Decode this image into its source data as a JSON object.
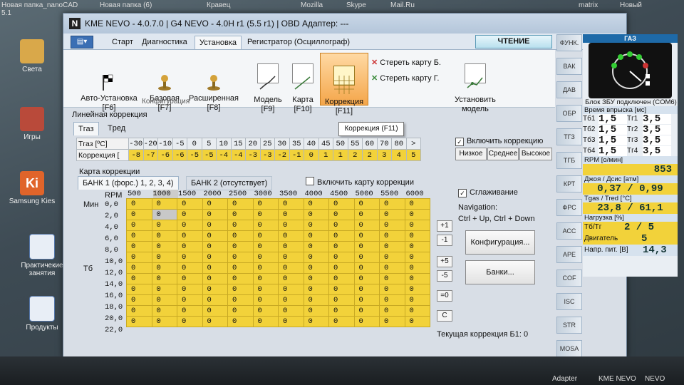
{
  "window": {
    "title": "KME NEVO - 4.0.7.0  |  G4 NEVO - 4.0H r1 (5.5 r1)  |  OBD Адаптер: ---"
  },
  "desktop": {
    "top_labels": [
      "Новая папка_nanoCAD 5.1",
      "Новая папка (6)",
      "Кравец",
      "Mozilla",
      "Skype",
      "Mail.Ru",
      "matrix",
      "Новый"
    ],
    "icons": [
      "Света",
      "Игры",
      "Samsung Kies",
      "Практичекие занятия",
      "Продукты"
    ],
    "taskbar_labels": [
      "Adapter",
      "KME NEVO",
      "NEVO"
    ]
  },
  "menu": {
    "tabs": [
      "Старт",
      "Диагностика",
      "Установка",
      "Регистратор (Осциллограф)"
    ],
    "active_tab": "Установка",
    "read_button": "ЧТЕНИЕ"
  },
  "ribbon": {
    "auto_setup": "Авто-Установка\n[F6]",
    "basic": "Базовая\n[F7]",
    "extended": "Расширенная\n[F8]",
    "group_label": "Конфигурация",
    "model": "Модель\n[F9]",
    "map": "Карта\n[F10]",
    "correction": "Коррекция\n[F11]",
    "erase_b": "Стереть карту Б.",
    "erase_g": "Стереть карту Г.",
    "install_model": "Установить\nмодель",
    "tooltip": "Коррекция (F11)"
  },
  "linear": {
    "title": "Линейная коррекция",
    "tabs": [
      "Tгаз",
      "Tред"
    ],
    "row1_label": "Tгаз    [ºC]",
    "row2_label": "Коррекция [",
    "temps": [
      "-30",
      "-20",
      "-10",
      "-5",
      "0",
      "5",
      "10",
      "15",
      "20",
      "25",
      "30",
      "35",
      "40",
      "45",
      "50",
      "55",
      "60",
      "70",
      "80",
      ">"
    ],
    "corrections": [
      "-8",
      "-7",
      "-6",
      "-6",
      "-5",
      "-5",
      "-4",
      "-4",
      "-3",
      "-3",
      "-2",
      "-1",
      "0",
      "1",
      "1",
      "2",
      "2",
      "3",
      "4",
      "5"
    ],
    "enable_label": "Включить коррекцию",
    "btn_low": "Низкое",
    "btn_mid": "Среднее",
    "btn_high": "Высокое"
  },
  "map": {
    "title": "Карта коррекции",
    "bank1_tab": "БАНК 1 (форс.) 1, 2, 3, 4)",
    "bank2_tab": "БАНК 2 (отсутствует)",
    "enable_map": "Включить карту коррекции",
    "rpm_label": "RPM",
    "min_label": "Мин",
    "tb_label": "Tб",
    "rpm": [
      "500",
      "1000",
      "1500",
      "2000",
      "2500",
      "3000",
      "3500",
      "4000",
      "4500",
      "5000",
      "5500",
      "6000"
    ],
    "rows": [
      "0,0",
      "2,0",
      "4,0",
      "6,0",
      "8,0",
      "10,0",
      "12,0",
      "14,0",
      "16,0",
      "18,0",
      "20,0",
      "22,0"
    ],
    "cell_value": "0",
    "smoothing": "Сглаживание",
    "nav_title": "Navigation:",
    "nav_keys": "Ctrl + Up, Ctrl + Down",
    "btn_plus1": "+1",
    "btn_minus1": "-1",
    "btn_plus5": "+5",
    "btn_minus5": "-5",
    "btn_eq0": "=0",
    "btn_c": "C",
    "config_button": "Конфигурация...",
    "banks_button": "Банки...",
    "current": "Текущая коррекция Б1: 0"
  },
  "sidetabs": [
    "ФУНК.",
    "ВАК",
    "ДАВ",
    "ОБР",
    "ТГЗ",
    "ТГБ",
    "КРТ",
    "ФРС",
    "АСС",
    "АРЕ",
    "COF",
    "ISC",
    "STR",
    "MOSA"
  ],
  "right_panel": {
    "header": "ГАЗ",
    "ecu_status": "Блок ЗБУ подключен (COM6)",
    "inj_title": "Время впрыска [мс]",
    "inj": [
      {
        "l1": "Tб1",
        "v1": "1,5",
        "l2": "Tг1",
        "v2": "3,5"
      },
      {
        "l1": "Tб2",
        "v1": "1,5",
        "l2": "Tг2",
        "v2": "3,5"
      },
      {
        "l1": "Tб3",
        "v1": "1,5",
        "l2": "Tг3",
        "v2": "3,5"
      },
      {
        "l1": "Tб4",
        "v1": "1,5",
        "l2": "Tг4",
        "v2": "3,5"
      }
    ],
    "rpm_label": "RPM [о/мин]",
    "rpm_value": "853",
    "pressure_label": "Джоя / Дсис [атм]",
    "pressure_value": "0,37 / 0,99",
    "temp_label": "Tgas / Tred [°C]",
    "temp_value": "23,8 / 61,1",
    "load_label": "Нагрузка [%]",
    "load_tb": "Tб/Тг",
    "load_tb_value": "2 / 5",
    "load_engine": "Двигатель",
    "load_engine_value": "5",
    "voltage_label": "Напр. пит. [В]",
    "voltage_value": "14,3"
  }
}
